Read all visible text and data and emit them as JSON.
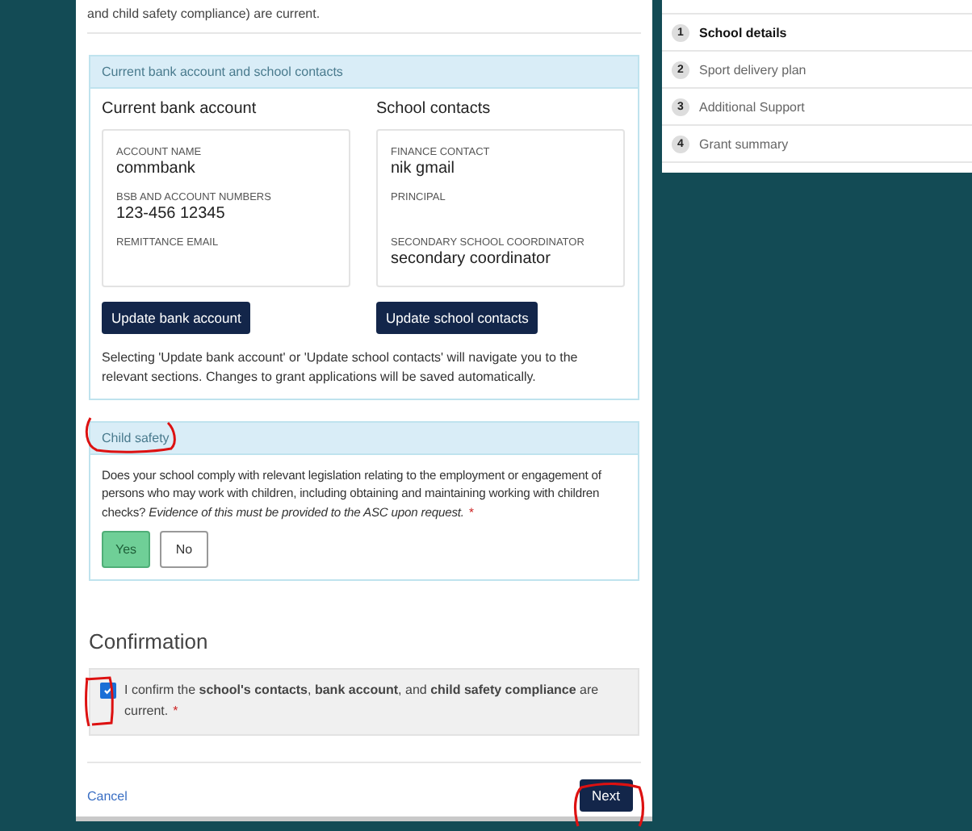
{
  "intro": "and child safety compliance) are current.",
  "contacts_card": {
    "title": "Current bank account and school contacts",
    "columns": [
      {
        "heading": "Current bank account",
        "fields": [
          {
            "label": "ACCOUNT NAME",
            "value": "commbank"
          },
          {
            "label": "BSB AND ACCOUNT NUMBERS",
            "value": "123-456 12345"
          },
          {
            "label": "REMITTANCE EMAIL"
          }
        ],
        "button": "Update bank account"
      },
      {
        "heading": "School contacts",
        "fields": [
          {
            "label": "FINANCE CONTACT",
            "value": "nik gmail"
          },
          {
            "label": "PRINCIPAL"
          },
          {
            "label": "SECONDARY SCHOOL COORDINATOR",
            "value": "secondary coordinator"
          }
        ],
        "button": "Update school contacts"
      }
    ],
    "note": "Selecting 'Update bank account' or 'Update school contacts' will navigate you to the relevant sections. Changes to grant applications will be saved automatically."
  },
  "child_safety": {
    "title": "Child safety",
    "question": "Does your school comply with relevant legislation relating to the employment or engagement of persons who may work with children, including obtaining and maintaining working with children checks? *Evidence of this must be provided to the ASC upon request.*",
    "required_mark": "*",
    "options": [
      {
        "label": "Yes",
        "selected": true
      },
      {
        "label": "No",
        "selected": false
      }
    ]
  },
  "confirmation": {
    "heading": "Confirmation",
    "checked": true,
    "text": "I confirm the **school's contacts**, **bank account**, and **child safety compliance** are current.",
    "required_mark": "*"
  },
  "actions": {
    "cancel": "Cancel",
    "next": "Next"
  },
  "steps": [
    {
      "number": "1",
      "label": "School details",
      "selected": true
    },
    {
      "number": "2",
      "label": "Sport delivery plan",
      "selected": false
    },
    {
      "number": "3",
      "label": "Additional Support",
      "selected": false
    },
    {
      "number": "4",
      "label": "Grant summary",
      "selected": false
    }
  ]
}
